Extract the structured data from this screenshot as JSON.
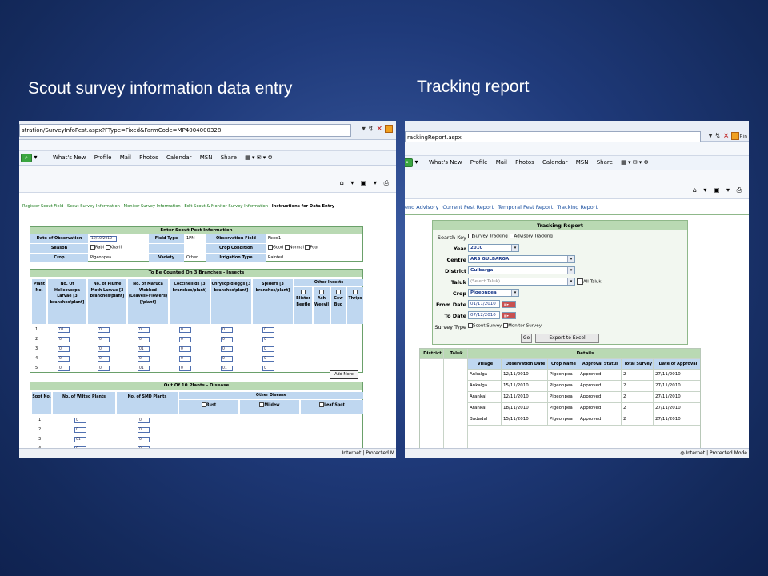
{
  "slide": {
    "left_title": "Scout survey information data entry",
    "right_title": "Tracking report"
  },
  "left_browser": {
    "url": "stration/SurveyInfoPest.aspx?FType=Fixed&FarmCode=MP4004000328",
    "links": [
      "What's New",
      "Profile",
      "Mail",
      "Photos",
      "Calendar",
      "MSN",
      "Share"
    ],
    "nav": [
      "Register Scout Field",
      "Scout Survey Information",
      "Monitor Survey Information",
      "Edit Scout & Monitor Survey Information",
      "Instructions for Data Entry"
    ],
    "status": "Internet | Protected M",
    "pest_info": {
      "header": "Enter Scout Pest Information",
      "date_label": "Date of Observation",
      "date_value": "19/10/2010",
      "field_type_label": "Field Type",
      "field_type_value": "1PM",
      "obs_field_label": "Observation Field",
      "obs_field_value": "Fixed1",
      "season_label": "Season",
      "season_opt1": "Rabi",
      "season_opt2": "Kharif",
      "crop_cond_label": "Crop Condition",
      "cond1": "Good",
      "cond2": "Normal",
      "cond3": "Poor",
      "crop_label": "Crop",
      "crop_value": "Pigeonpea",
      "variety_label": "Variety",
      "variety_value": "Other",
      "irrigation_label": "Irrigation Type",
      "irrigation_value": "Rainfed"
    },
    "insects": {
      "header": "To Be Counted On 3 Branches - Insects",
      "cols": [
        "Plant No.",
        "No. Of Helicoverpa Larvae [3 branches/plant]",
        "No. of Plume Moth Larvae [3 branches/plant]",
        "No. of Maruca Webbed (Leaves+Flowers) [/plant]",
        "Coccinellids [3 branches/plant]",
        "Chrysopid eggs [3 branches/plant]",
        "Spiders [3 branches/plant]"
      ],
      "other_header": "Other Insects",
      "other": [
        "Blister Beetle",
        "Ash Weevil",
        "Cow Bug",
        "Thrips"
      ],
      "rows": [
        "1",
        "2",
        "3",
        "4",
        "5"
      ],
      "values": [
        [
          "01",
          "0",
          "0",
          "0",
          "0",
          "0"
        ],
        [
          "0",
          "0",
          "0",
          "0",
          "0",
          "0"
        ],
        [
          "0",
          "0",
          "01",
          "0",
          "0",
          "0"
        ],
        [
          "0",
          "0",
          "0",
          "0",
          "0",
          "0"
        ],
        [
          "0",
          "0",
          "01",
          "0",
          "01",
          "0"
        ]
      ],
      "add_more": "Add More"
    },
    "disease": {
      "header": "Out Of 10 Plants - Disease",
      "cols": [
        "Spot No.",
        "No. of Wilted Plants",
        "No. of SMD Plants"
      ],
      "other_header": "Other Disease",
      "other": [
        "Rust",
        "Mildew",
        "Leaf Spot"
      ],
      "rows": [
        "1",
        "2",
        "3",
        "4"
      ],
      "values": [
        [
          "0",
          "0"
        ],
        [
          "0",
          "0"
        ],
        [
          "01",
          "0"
        ],
        [
          "0",
          "0"
        ]
      ]
    }
  },
  "right_browser": {
    "url": "rackingReport.aspx",
    "links": [
      "What's New",
      "Profile",
      "Mail",
      "Photos",
      "Calendar",
      "MSN",
      "Share"
    ],
    "nav": [
      "end Advisory",
      "Current Pest Report",
      "Temporal Pest Report",
      "Tracking Report"
    ],
    "status": "Internet | Protected Mode",
    "search_tab": "Bin",
    "form": {
      "header": "Tracking Report",
      "search_key_label": "Search Key",
      "search_opt1": "Survey Tracking",
      "search_opt2": "Advisory Tracking",
      "year_label": "Year",
      "year_value": "2010",
      "centre_label": "Centre",
      "centre_value": "ARS GULBARGA",
      "district_label": "District",
      "district_value": "Gulbarga",
      "taluk_label": "Taluk",
      "taluk_value": "(Select Taluk)",
      "all_taluk": "All Taluk",
      "crop_label": "Crop",
      "crop_value": "Pigeonpea",
      "from_label": "From Date",
      "from_value": "01/11/2010",
      "to_label": "To Date",
      "to_value": "07/12/2010",
      "survey_type_label": "Survey Type",
      "survey_opt1": "Scout Survey",
      "survey_opt2": "Monitor Survey",
      "go": "Go",
      "export": "Export to Excel"
    },
    "table": {
      "district": "District",
      "taluk": "Taluk",
      "details": "Details",
      "cols": [
        "Village",
        "Observation Date",
        "Crop Name",
        "Approval Status",
        "Total Survey",
        "Date of Approval"
      ],
      "rows": [
        [
          "Ankalga",
          "12/11/2010",
          "Pigeonpea",
          "Approved",
          "2",
          "27/11/2010"
        ],
        [
          "Ankalga",
          "15/11/2010",
          "Pigeonpea",
          "Approved",
          "2",
          "27/11/2010"
        ],
        [
          "Arankal",
          "12/11/2010",
          "Pigeonpea",
          "Approved",
          "2",
          "27/11/2010"
        ],
        [
          "Arankal",
          "18/11/2010",
          "Pigeonpea",
          "Approved",
          "2",
          "27/11/2010"
        ],
        [
          "Badadal",
          "15/11/2010",
          "Pigeonpea",
          "Approved",
          "2",
          "27/11/2010"
        ]
      ]
    }
  }
}
